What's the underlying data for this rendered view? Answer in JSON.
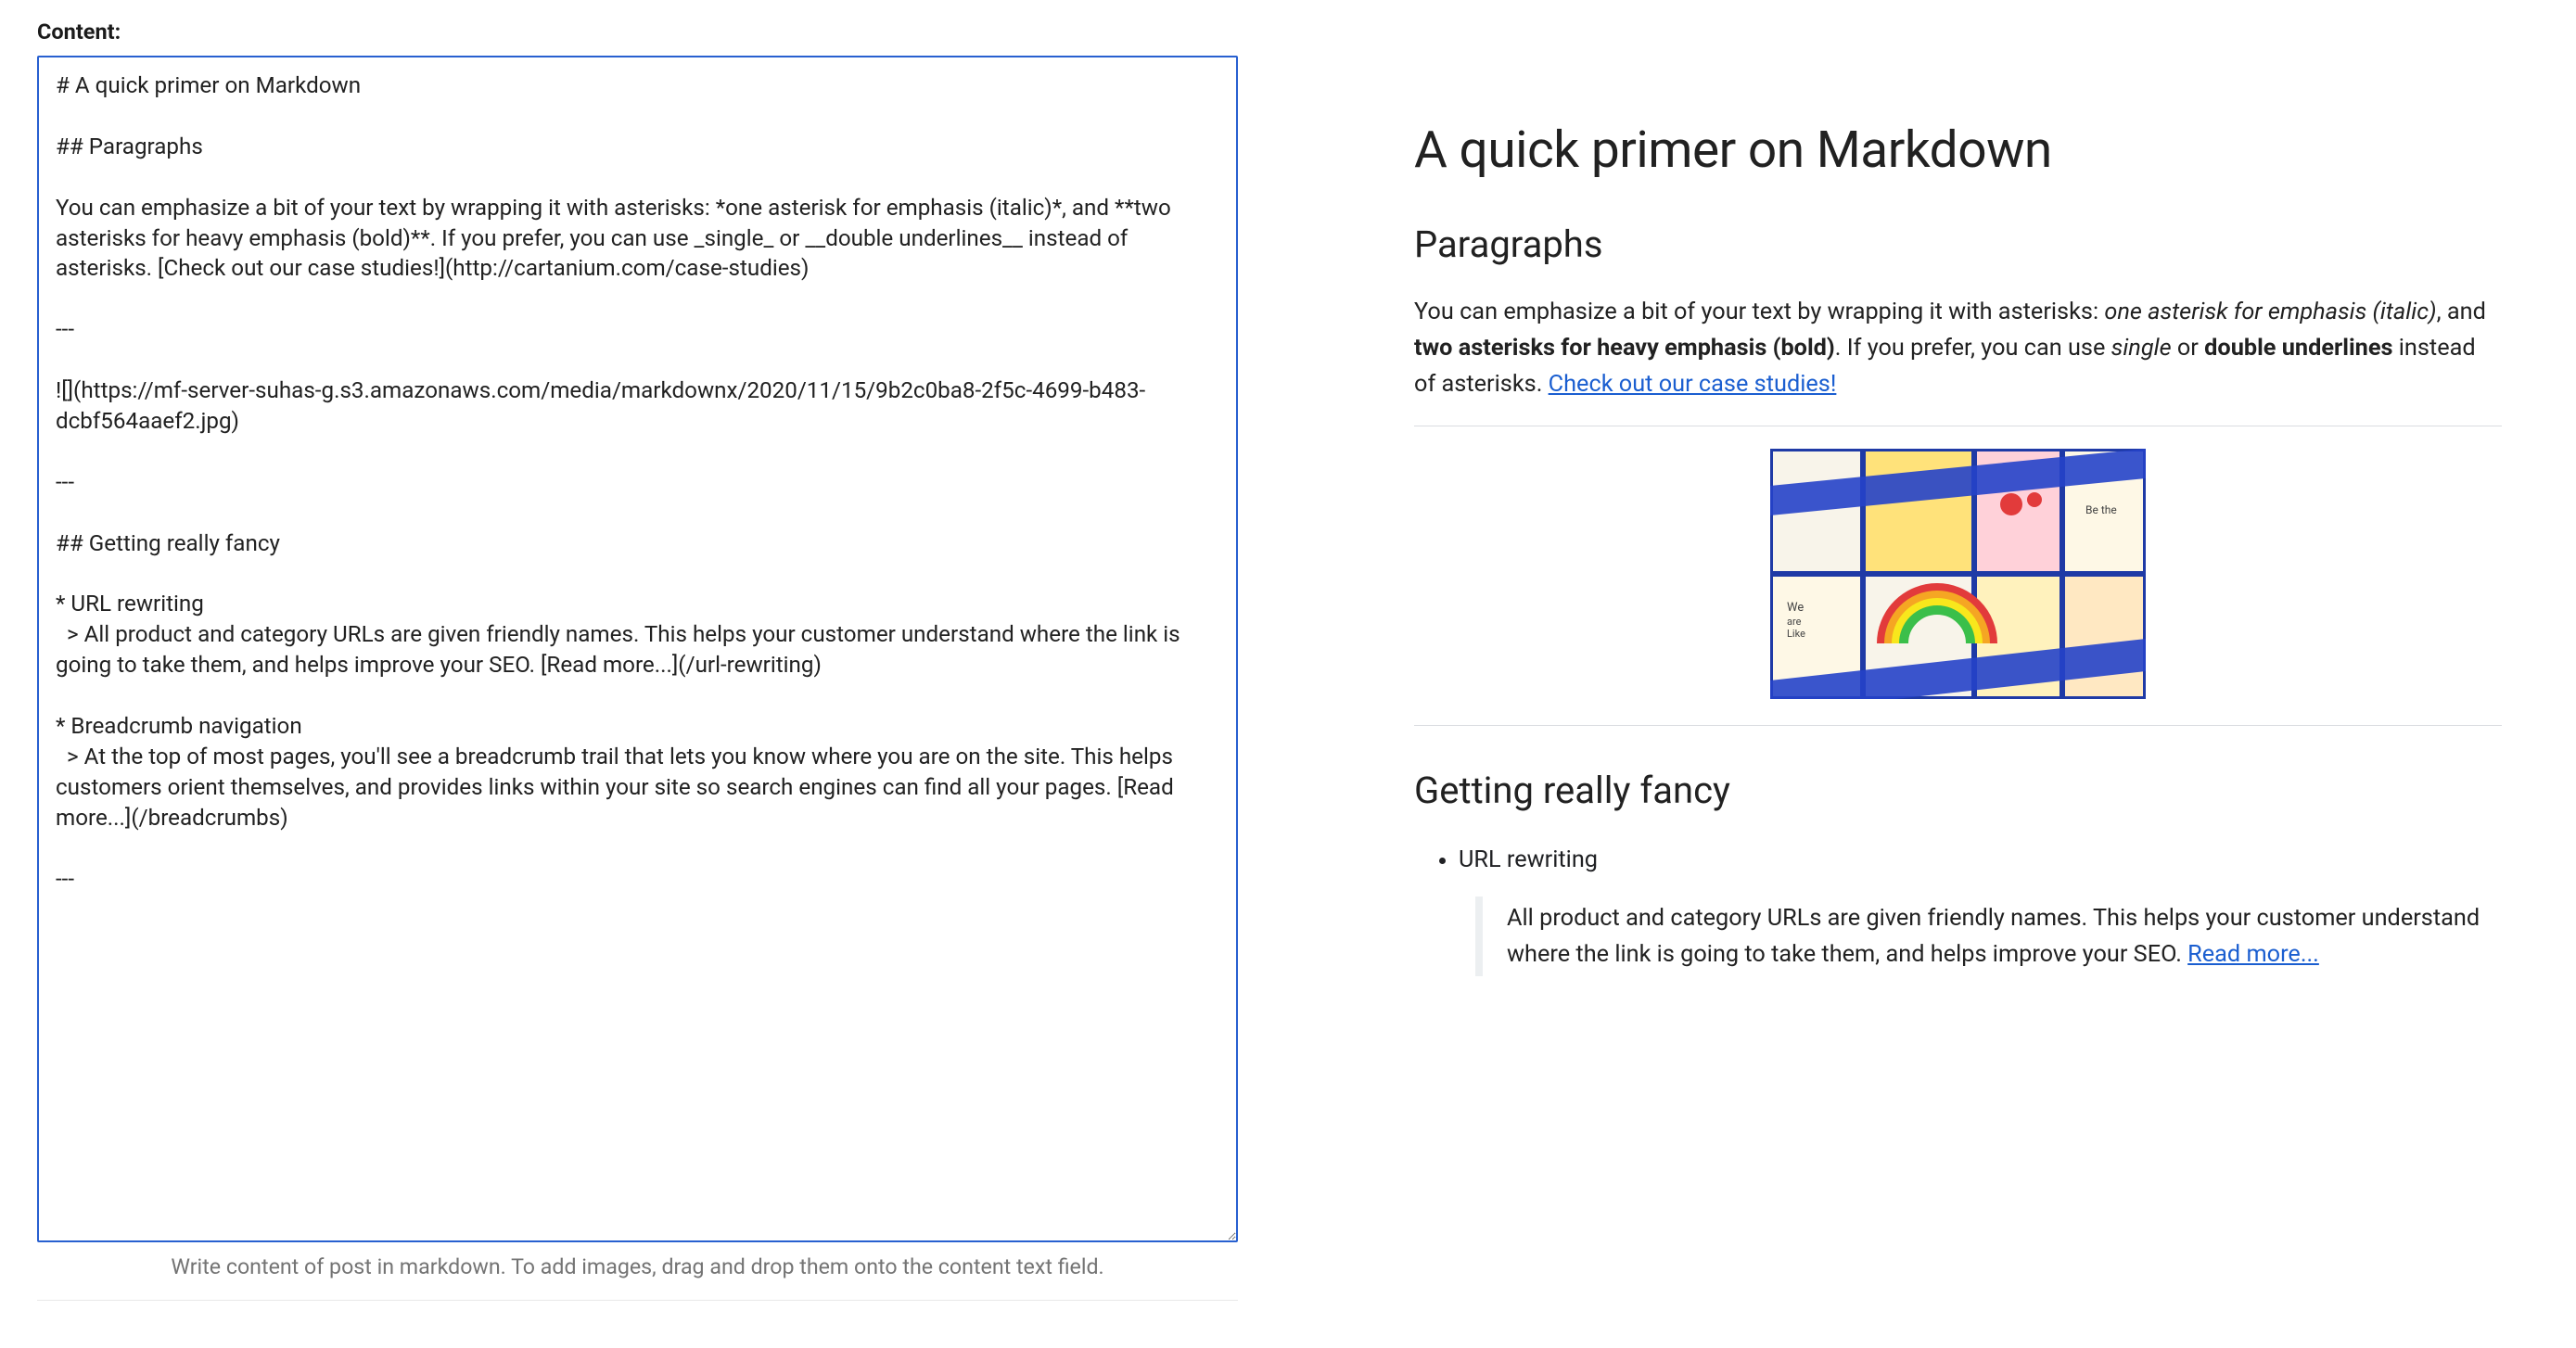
{
  "editor": {
    "field_label": "Content:",
    "textarea_value": "# A quick primer on Markdown\n\n## Paragraphs\n\nYou can emphasize a bit of your text by wrapping it with asterisks: *one asterisk for emphasis (italic)*, and **two asterisks for heavy emphasis (bold)**. If you prefer, you can use _single_ or __double underlines__ instead of asterisks. [Check out our case studies!](http://cartanium.com/case-studies)\n\n---\n\n![](https://mf-server-suhas-g.s3.amazonaws.com/media/markdownx/2020/11/15/9b2c0ba8-2f5c-4699-b483-dcbf564aaef2.jpg)\n\n---\n\n## Getting really fancy\n\n* URL rewriting\n  > All product and category URLs are given friendly names. This helps your customer understand where the link is going to take them, and helps improve your SEO. [Read more...](/url-rewriting)\n\n* Breadcrumb navigation\n  > At the top of most pages, you'll see a breadcrumb trail that lets you know where you are on the site. This helps customers orient themselves, and provides links within your site so search engines can find all your pages. [Read more...](/breadcrumbs)\n\n---",
    "help_text": "Write content of post in markdown. To add images, drag and drop them onto the content text field."
  },
  "preview": {
    "h1": "A quick primer on Markdown",
    "h2_paragraphs": "Paragraphs",
    "para_prefix": "You can emphasize a bit of your text by wrapping it with asterisks: ",
    "em1": "one asterisk for emphasis (italic)",
    "para_sep1": ", and ",
    "strong1": "two asterisks for heavy emphasis (bold)",
    "para_sep2": ". If you prefer, you can use ",
    "em2": "single",
    "para_sep3": " or ",
    "strong2": "double underlines",
    "para_sep4": " instead of asterisks. ",
    "link1_text": "Check out our case studies!",
    "h2_fancy": "Getting really fancy",
    "li1": "URL rewriting",
    "bq1_main": "All product and category URLs are given friendly names. This helps your customer understand where the link is going to take them, and helps improve your SEO. ",
    "bq1_link": "Read more..."
  }
}
